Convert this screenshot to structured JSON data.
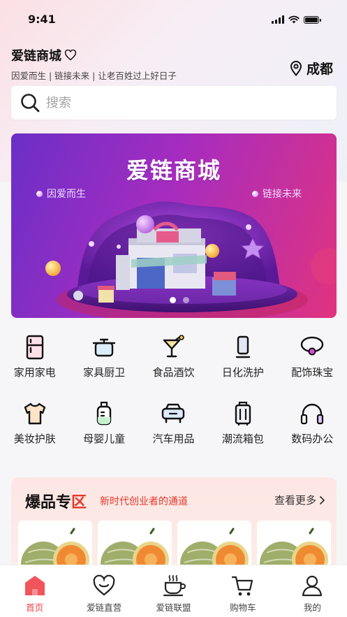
{
  "status": {
    "time": "9:41"
  },
  "header": {
    "title": "爱链商城",
    "slogan": "因爱而生 | 链接未来 | 让老百姓过上好日子",
    "location": "成都"
  },
  "search": {
    "placeholder": "搜索"
  },
  "banner": {
    "title": "爱链商城",
    "sub_left": "因爱而生",
    "sub_right": "链接未来",
    "slide_count": 2,
    "active_slide": 1
  },
  "categories": [
    {
      "label": "家用家电",
      "icon": "fridge-icon"
    },
    {
      "label": "家具厨卫",
      "icon": "cooking-pot-icon"
    },
    {
      "label": "食品酒饮",
      "icon": "cocktail-icon"
    },
    {
      "label": "日化洗护",
      "icon": "bottle-icon"
    },
    {
      "label": "配饰珠宝",
      "icon": "necklace-icon"
    },
    {
      "label": "美妆护肤",
      "icon": "tshirt-icon"
    },
    {
      "label": "母婴儿童",
      "icon": "baby-bottle-icon"
    },
    {
      "label": "汽车用品",
      "icon": "car-icon"
    },
    {
      "label": "潮流箱包",
      "icon": "suitcase-icon"
    },
    {
      "label": "数码办公",
      "icon": "headphones-icon"
    }
  ],
  "hot": {
    "title_prefix": "爆品专",
    "title_suffix": "区",
    "subtitle": "新时代创业者的通道",
    "more": "查看更多"
  },
  "tabs": [
    {
      "label": "首页",
      "icon": "home-icon",
      "active": true
    },
    {
      "label": "爱链直营",
      "icon": "heart-icon",
      "active": false
    },
    {
      "label": "爱链联盟",
      "icon": "coffee-cup-icon",
      "active": false
    },
    {
      "label": "购物车",
      "icon": "cart-icon",
      "active": false
    },
    {
      "label": "我的",
      "icon": "user-icon",
      "active": false
    }
  ],
  "colors": {
    "accent": "#f0424b",
    "hot_subtitle": "#e3372a",
    "banner_start": "#6a2fc7",
    "banner_end": "#e0337f"
  }
}
